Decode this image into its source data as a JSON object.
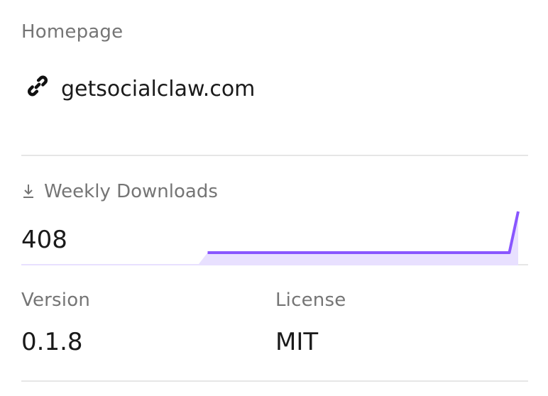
{
  "homepage": {
    "label": "Homepage",
    "link_text": "getsocialclaw.com",
    "icon": "link-icon"
  },
  "downloads": {
    "label": "Weekly Downloads",
    "value": "408",
    "icon": "download-icon",
    "sparkline": {
      "values": [
        0,
        0,
        0,
        0,
        0,
        0,
        0,
        0,
        0,
        0,
        0,
        0,
        0,
        0,
        0,
        0,
        0,
        0,
        0,
        0,
        0,
        1,
        1,
        1,
        1,
        1,
        1,
        1,
        1,
        1,
        1,
        1,
        1,
        1,
        1,
        1,
        1,
        1,
        1,
        1,
        1,
        1,
        1,
        1,
        1,
        1,
        1,
        1,
        1,
        1,
        1,
        1,
        1,
        1,
        1,
        1,
        408
      ],
      "line_color": "#8956ff",
      "fill_color": "#e8e0ff"
    }
  },
  "version": {
    "label": "Version",
    "value": "0.1.8"
  },
  "license": {
    "label": "License",
    "value": "MIT"
  }
}
